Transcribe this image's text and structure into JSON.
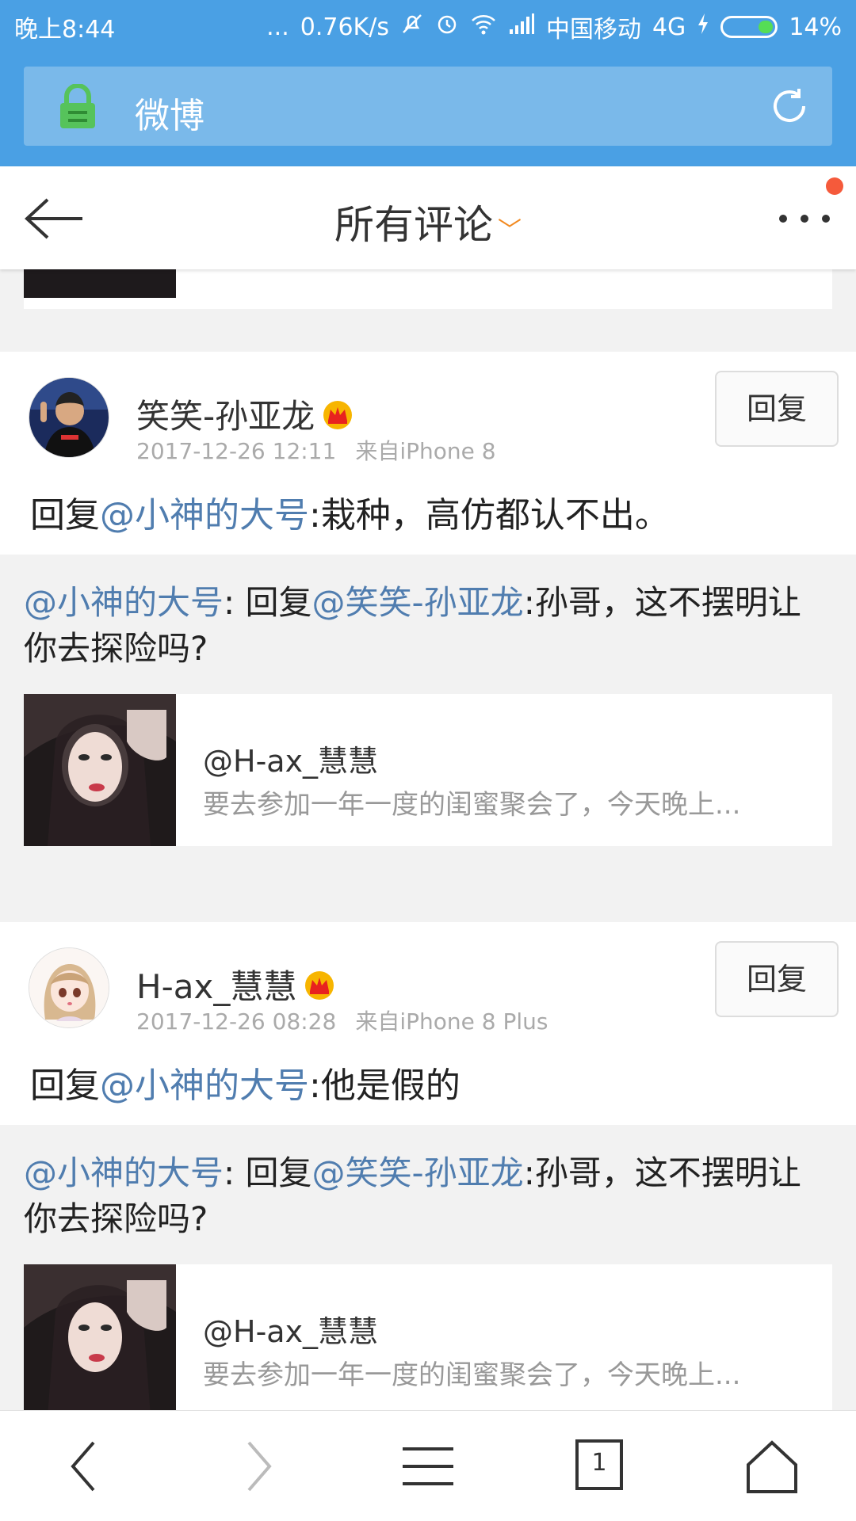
{
  "status_bar": {
    "time": "晚上8:44",
    "dots": "...",
    "speed": "0.76K/s",
    "carrier": "中国移动",
    "network": "4G",
    "battery": "14%"
  },
  "browser": {
    "url_title": "微博"
  },
  "nav": {
    "title": "所有评论",
    "chevron": "﹀"
  },
  "comments": [
    {
      "username": "笑笑-孙亚龙",
      "time": "2017-12-26 12:11",
      "source": "来自iPhone 8",
      "reply_label": "回复",
      "text_prefix": "回复",
      "text_mention": "@小神的大号",
      "text_body": ":栽种，高仿都认不出。",
      "quote_mention": "@小神的大号",
      "quote_colon": ": 回复",
      "quote_mention2": "@笑笑-孙亚龙",
      "quote_body": ":孙哥，这不摆明让你去探险吗?",
      "share_title": "@H-ax_慧慧",
      "share_sub": "要去参加一年一度的闺蜜聚会了，今天晚上..."
    },
    {
      "username": "H-ax_慧慧",
      "time": "2017-12-26 08:28",
      "source": "来自iPhone 8 Plus",
      "reply_label": "回复",
      "text_prefix": "回复",
      "text_mention": "@小神的大号",
      "text_body": ":他是假的",
      "quote_mention": "@小神的大号",
      "quote_colon": ": 回复",
      "quote_mention2": "@笑笑-孙亚龙",
      "quote_body": ":孙哥，这不摆明让你去探险吗?",
      "share_title": "@H-ax_慧慧",
      "share_sub": "要去参加一年一度的闺蜜聚会了，今天晚上..."
    }
  ],
  "bottom_bar": {
    "tab_count": "1"
  },
  "colors": {
    "header_blue": "#4aa0e4",
    "link_blue": "#507daf",
    "accent_orange": "#f28a21",
    "notification_red": "#f55a3b"
  }
}
